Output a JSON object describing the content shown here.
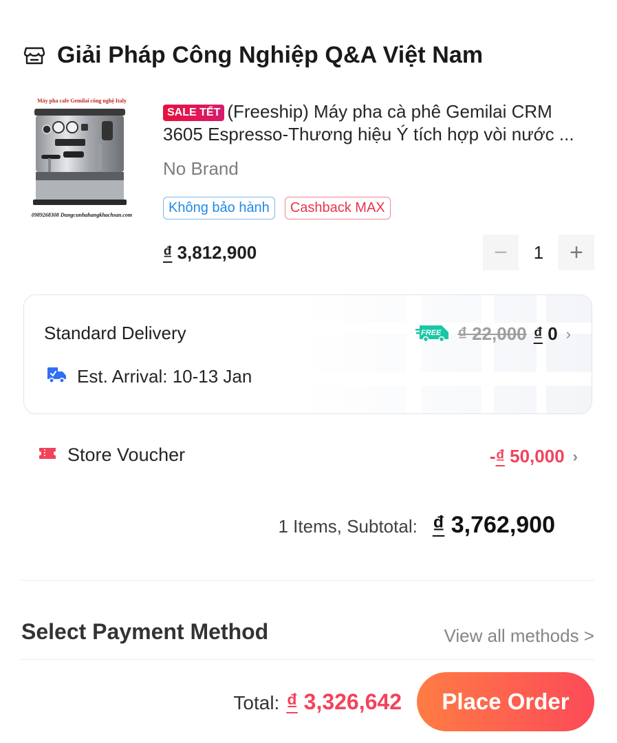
{
  "store": {
    "icon": "store-icon",
    "name": "Giải Pháp Công Nghiệp Q&A Việt Nam"
  },
  "product": {
    "image_caption_top": "Máy pha cafe Gemilai công nghệ Italy",
    "image_caption_bottom": "0989268308 Dungcunhahangkhachsan.com",
    "sale_badge": "SALE TẾT",
    "title_line1": "(Freeship) Máy pha cà phê Gemilai CRM",
    "title_line2": "3605 Espresso-Thương hiệu Ý tích hợp vòi nước ...",
    "brand": "No Brand",
    "tags": [
      "Không bảo hành",
      "Cashback MAX"
    ],
    "currency": "₫",
    "price": "3,812,900",
    "quantity": "1",
    "qty_minus": "−",
    "qty_plus": "+"
  },
  "delivery": {
    "title": "Standard Delivery",
    "free_badge": "FREE",
    "old_fee": "₫ 22,000",
    "currency": "₫",
    "new_fee": "0",
    "arrival": "Est. Arrival: 10-13 Jan",
    "chevron": "›"
  },
  "voucher": {
    "label": "Store Voucher",
    "prefix": "-",
    "currency": "₫",
    "amount": "50,000",
    "chevron": "›"
  },
  "subtotal": {
    "label": "1 Items, Subtotal:",
    "currency": "₫",
    "value": "3,762,900"
  },
  "payment": {
    "title": "Select Payment Method",
    "view_all": "View all methods >"
  },
  "footer": {
    "total_label": "Total:",
    "currency": "₫",
    "total_value": "3,326,642",
    "place_order": "Place Order"
  },
  "colors": {
    "accent_red": "#f2435b",
    "button_gradient_start": "#ff7c44",
    "button_gradient_end": "#fc4a58",
    "free_green": "#19c7a5",
    "tag_blue": "#1f8ae6"
  }
}
